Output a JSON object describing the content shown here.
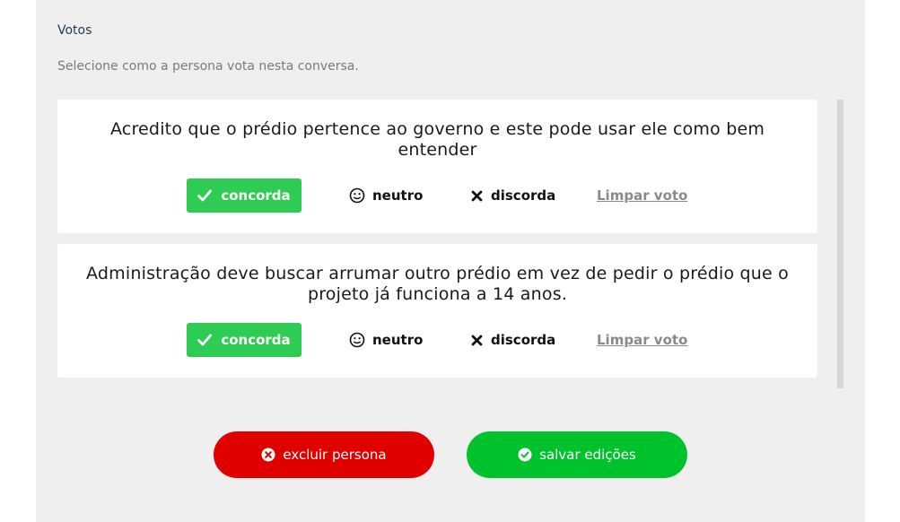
{
  "votes_section": {
    "title": "Votos",
    "subtitle": "Selecione como a persona vota nesta conversa."
  },
  "comments": [
    {
      "text": "Acredito que o prédio pertence ao governo e este pode usar ele como bem entender",
      "selected_vote": "concorda"
    },
    {
      "text": "Administração deve buscar arrumar outro prédio em vez de pedir o prédio que o projeto já funciona a 14 anos.",
      "selected_vote": "concorda"
    }
  ],
  "vote_options": {
    "agree_label": "concorda",
    "neutral_label": "neutro",
    "disagree_label": "discorda",
    "clear_label": "Limpar voto"
  },
  "actions": {
    "delete_label": "excluir persona",
    "save_label": "salvar edições"
  },
  "colors": {
    "agree": "#2ecc52",
    "delete": "#e10000",
    "save": "#00c22d"
  },
  "icons": {
    "agree": "check-icon",
    "neutral": "neutral-face-icon",
    "disagree": "x-icon",
    "delete": "x-circle-icon",
    "save": "check-circle-icon"
  }
}
